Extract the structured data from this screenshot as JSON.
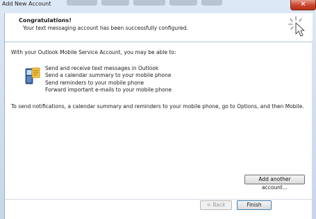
{
  "window": {
    "title": "Add New Account",
    "close_glyph": "✕"
  },
  "header": {
    "title": "Congratulations!",
    "subtitle": "Your text messaging account has been successfully configured.",
    "icon": "wizard-cursor-icon"
  },
  "body": {
    "intro": "With your Outlook Mobile Service Account, you may be able to:",
    "features_icon": "mobile-phone-icon",
    "features": [
      "Send and receive text messages in Outlook",
      "Send a calendar summary to your mobile phone",
      "Send reminders to your mobile phone",
      "Forward important e-mails to your mobile phone"
    ],
    "note": "To send notifications, a calendar summary and reminders to your mobile phone, go to Options, and then Mobile."
  },
  "buttons": {
    "add_another": "Add another account...",
    "back": "< Back",
    "finish": "Finish"
  }
}
